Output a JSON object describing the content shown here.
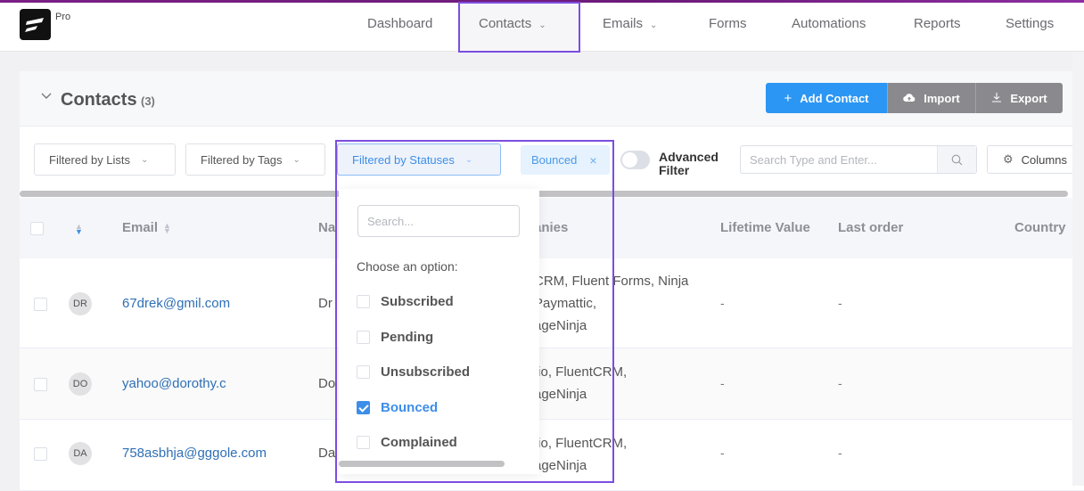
{
  "app": {
    "badge": "Pro",
    "logo_icon": "fluent-logo-icon"
  },
  "nav": {
    "items": [
      {
        "label": "Dashboard",
        "has_dropdown": false
      },
      {
        "label": "Contacts",
        "has_dropdown": true,
        "active": true
      },
      {
        "label": "Emails",
        "has_dropdown": true
      },
      {
        "label": "Forms",
        "has_dropdown": false
      },
      {
        "label": "Automations",
        "has_dropdown": false
      },
      {
        "label": "Reports",
        "has_dropdown": false
      },
      {
        "label": "Settings",
        "has_dropdown": false
      }
    ]
  },
  "panel": {
    "title": "Contacts",
    "count": "(3)",
    "actions": {
      "add": {
        "label": "Add Contact",
        "icon": "plus-icon"
      },
      "import": {
        "label": "Import",
        "icon": "cloud-upload-icon"
      },
      "export": {
        "label": "Export",
        "icon": "download-icon"
      }
    }
  },
  "filters": {
    "lists": "Filtered by Lists",
    "tags": "Filtered by Tags",
    "statuses": "Filtered by Statuses",
    "active_tag": "Bounced",
    "advanced_filter": {
      "label_line1": "Advanced",
      "label_line2": "Filter",
      "enabled": false
    },
    "search_placeholder": "Search Type and Enter...",
    "columns_label": "Columns"
  },
  "table": {
    "headers": {
      "email": "Email",
      "name": "Na",
      "companies": "anies",
      "lifetime_value": "Lifetime Value",
      "last_order": "Last order",
      "country": "Country"
    },
    "rows": [
      {
        "initials": "DR",
        "email": "67drek@gmil.com",
        "name": "Dr",
        "companies": [
          "CRM, Fluent Forms, Ninja",
          "Paymattic,",
          "ageNinja"
        ],
        "lifetime_value": "-",
        "last_order": "-"
      },
      {
        "initials": "DO",
        "email": "yahoo@dorothy.c",
        "name": "Do",
        "companies": [
          ".io, FluentCRM,",
          "ageNinja"
        ],
        "lifetime_value": "-",
        "last_order": "-"
      },
      {
        "initials": "DA",
        "email": "758asbhja@gggole.com",
        "name": "Da",
        "companies": [
          ".io, FluentCRM,",
          "ageNinja"
        ],
        "lifetime_value": "-",
        "last_order": "-"
      }
    ]
  },
  "status_dropdown": {
    "search_placeholder": "Search...",
    "prompt": "Choose an option:",
    "options": [
      {
        "label": "Subscribed",
        "checked": false
      },
      {
        "label": "Pending",
        "checked": false
      },
      {
        "label": "Unsubscribed",
        "checked": false
      },
      {
        "label": "Bounced",
        "checked": true
      },
      {
        "label": "Complained",
        "checked": false
      }
    ]
  },
  "colors": {
    "accent": "#2b96f3",
    "highlight_outline": "#7b4ee0",
    "link": "#2e6fb6",
    "top_bar": "#7a1f85"
  }
}
